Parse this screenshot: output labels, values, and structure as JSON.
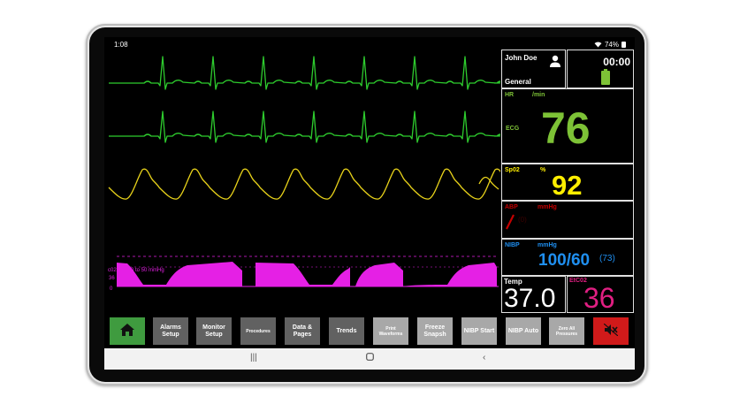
{
  "status_bar": {
    "time": "1:08",
    "battery_percent": "74%"
  },
  "patient": {
    "name": "John Doe",
    "type": "General"
  },
  "timer": {
    "value": "00:00"
  },
  "hr": {
    "label": "HR",
    "unit": "/min",
    "source": "ECG",
    "value": "76",
    "color": "#7dc236"
  },
  "spo2": {
    "label": "Sp02",
    "unit": "%",
    "value": "92",
    "color": "#ffee00"
  },
  "abp": {
    "label": "ABP",
    "unit": "mmHg",
    "value": "(0)",
    "color": "#c40000"
  },
  "nibp": {
    "label": "NIBP",
    "unit": "mmHg",
    "value": "100/60",
    "mean": "(73)",
    "color": "#1f8ff0"
  },
  "temp": {
    "label": "Temp",
    "value": "37.0",
    "color": "#ffffff"
  },
  "etco2": {
    "label": "EtC02",
    "value": "36",
    "color": "#e01f82"
  },
  "co2_wave": {
    "label": "c02",
    "range": "0  to  50 mmHg",
    "tick_high": "36",
    "tick_low": "0",
    "color": "#e520e5"
  },
  "buttons": {
    "alarms_setup": "Alarms Setup",
    "monitor_setup": "Monitor Setup",
    "procedures": "Procedures",
    "data_pages": "Data & Pages",
    "trends": "Trends",
    "print_waveforms": "Print Waveforms",
    "freeze_snapsh": "Freeze Snapsh",
    "nibp_start": "NIBP Start",
    "nibp_auto": "NIBP Auto",
    "zero_all": "Zero All Pressures"
  },
  "icons": {
    "home": "home-icon",
    "mute": "speaker-mute-icon",
    "person": "person-icon",
    "battery": "battery-icon",
    "wifi": "wifi-icon"
  },
  "colors": {
    "ecg": "#2ecc2e",
    "pleth": "#e8d21a"
  }
}
